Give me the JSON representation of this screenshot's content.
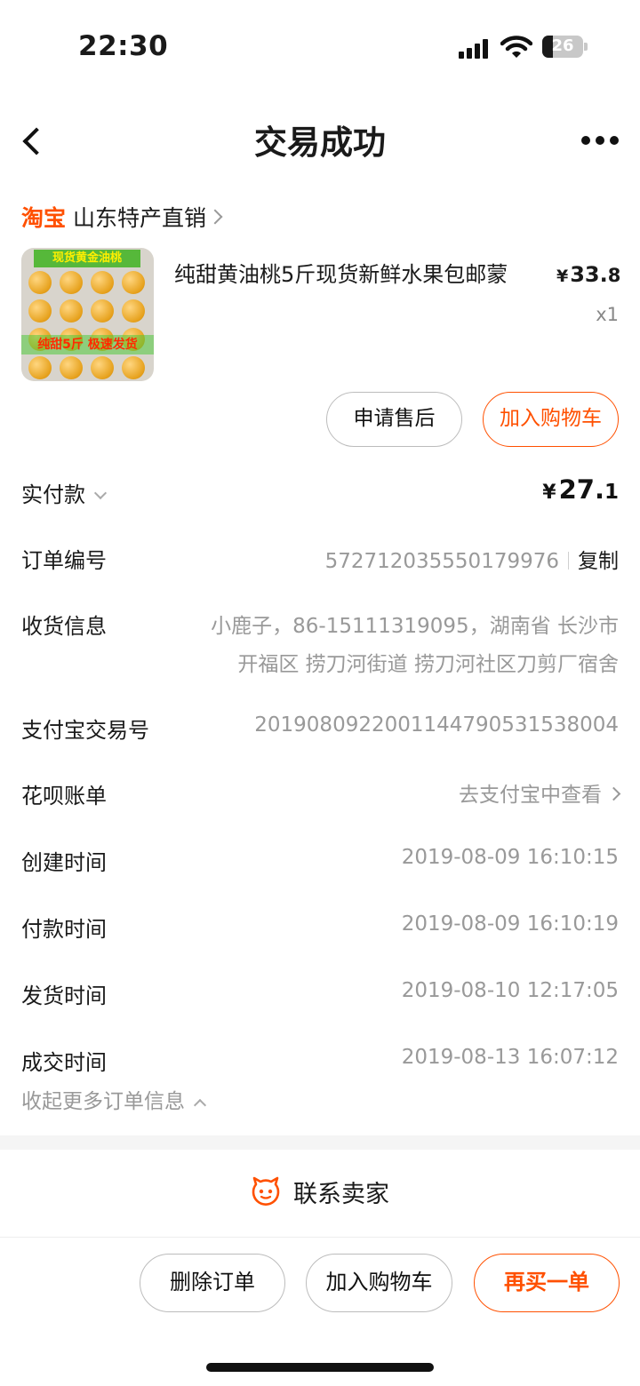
{
  "status_bar": {
    "time": "22:30",
    "battery": "26",
    "battery_level_percent": 26,
    "icons": [
      "signal-icon",
      "wifi-icon",
      "battery-icon"
    ]
  },
  "nav": {
    "back_icon": "chevron-left-icon",
    "title": "交易成功",
    "more_icon": "more-dots-icon"
  },
  "shop": {
    "logo": "淘宝",
    "name": "山东特产直销"
  },
  "product": {
    "image_banner_top": "现货黄金油桃",
    "image_banner_bottom": "纯甜5斤  极速发货",
    "title": "纯甜黄油桃5斤现货新鲜水果包邮蒙",
    "price_symbol": "¥",
    "price_int": "33.",
    "price_dec": "8",
    "quantity": "x1"
  },
  "item_actions": {
    "after_sale": "申请售后",
    "add_cart": "加入购物车"
  },
  "order_info": {
    "paid_label": "实付款",
    "paid_symbol": "¥",
    "paid_int": "27.",
    "paid_dec": "1",
    "order_no_label": "订单编号",
    "order_no": "572712035550179976",
    "copy": "复制",
    "receiver_label": "收货信息",
    "receiver_line1": "小鹿子，86-15111319095，湖南省 长沙市",
    "receiver_line2": "开福区 捞刀河街道 捞刀河社区刀剪厂宿舍",
    "alipay_no_label": "支付宝交易号",
    "alipay_no": "2019080922001144790531538004",
    "huabei_label": "花呗账单",
    "huabei_value": "去支付宝中查看",
    "created_label": "创建时间",
    "created": "2019-08-09 16:10:15",
    "paid_time_label": "付款时间",
    "paid_time": "2019-08-09 16:10:19",
    "shipped_label": "发货时间",
    "shipped": "2019-08-10 12:17:05",
    "completed_label": "成交时间",
    "completed": "2019-08-13 16:07:12",
    "collapse": "收起更多订单信息"
  },
  "contact": {
    "icon": "seller-chat-icon",
    "label": "联系卖家"
  },
  "bottom_bar": {
    "delete": "删除订单",
    "add_cart": "加入购物车",
    "rebuy": "再买一单"
  },
  "colors": {
    "accent": "#ff5000",
    "muted_text": "#999999",
    "divider": "#f5f5f5"
  }
}
